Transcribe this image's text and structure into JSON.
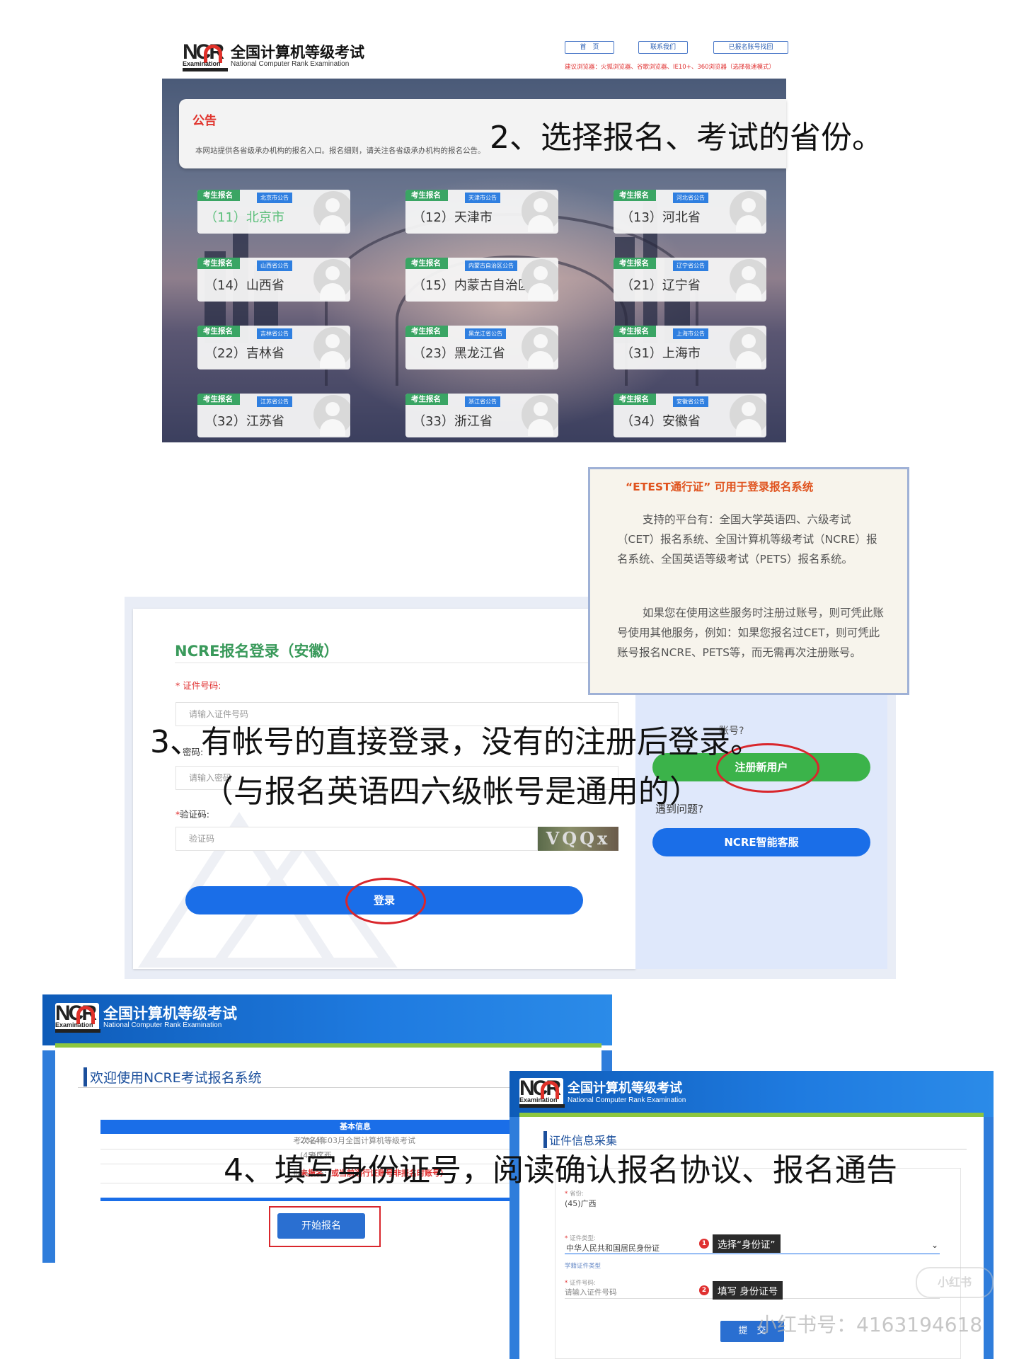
{
  "panel1": {
    "logo": {
      "mark": "NCR",
      "ex": "Examination",
      "title": "全国计算机等级考试",
      "subtitle": "National Computer Rank Examination"
    },
    "nav": [
      "首　页",
      "联系我们",
      "已报名账号找回"
    ],
    "browser_tip": "建议浏览器：火狐浏览器、谷歌浏览器、IE10+、360浏览器（选择极速模式）",
    "notice_title": "公告",
    "notice_text": "本网站提供各省级承办机构的报名入口。报名细则，请关注各省级承办机构的报名公告。",
    "annotation": "2、选择报名、考试的省份。",
    "reg_tag": "考生报名",
    "provinces": [
      {
        "name": "（11）北京市",
        "notice": "北京市公告",
        "highlight": true
      },
      {
        "name": "（12）天津市",
        "notice": "天津市公告"
      },
      {
        "name": "（13）河北省",
        "notice": "河北省公告"
      },
      {
        "name": "（14）山西省",
        "notice": "山西省公告"
      },
      {
        "name": "（15）内蒙古自治区",
        "notice": "内蒙古自治区公告"
      },
      {
        "name": "（21）辽宁省",
        "notice": "辽宁省公告"
      },
      {
        "name": "（22）吉林省",
        "notice": "吉林省公告"
      },
      {
        "name": "（23）黑龙江省",
        "notice": "黑龙江省公告"
      },
      {
        "name": "（31）上海市",
        "notice": "上海市公告"
      },
      {
        "name": "（32）江苏省",
        "notice": "江苏省公告"
      },
      {
        "name": "（33）浙江省",
        "notice": "浙江省公告"
      },
      {
        "name": "（34）安徽省",
        "notice": "安徽省公告"
      }
    ]
  },
  "panel2": {
    "title": "NCRE报名登录（安徽）",
    "id_label": "证件号码:",
    "id_placeholder": "请输入证件号码",
    "pwd_label": "密码:",
    "pwd_placeholder": "请输入密码",
    "captcha_label": "验证码:",
    "captcha_placeholder": "验证码",
    "captcha_text": "VQQx",
    "login_button": "登录",
    "account_question": "账号?",
    "register_button": "注册新用户",
    "help_question": "遇到问题?",
    "service_button": "NCRE智能客服",
    "popup": {
      "title": "“ETEST通行证” 可用于登录报名系统",
      "para1": "支持的平台有：全国大学英语四、六级考试（CET）报名系统、全国计算机等级考试（NCRE）报名系统、全国英语等级考试（PETS）报名系统。",
      "para2": "如果您在使用这些服务时注册过账号，则可凭此账号使用其他服务，例如：如果您报名过CET，则可凭此账号报名NCRE、PETS等，而无需再次注册账号。"
    },
    "annotation_line1": "3、有帐号的直接登录，没有的注册后登录。",
    "annotation_line2": "（与报名英语四六级帐号是通用的）"
  },
  "panel3": {
    "logo": {
      "mark": "NCR",
      "ex": "Examination",
      "title": "全国计算机等级考试",
      "subtitle": "National Computer Rank Examination"
    },
    "welcome": "欢迎使用NCRE考试报名系统",
    "info_header": "基本信息",
    "rows": [
      {
        "key": "考次名称:",
        "value": "2024年03月全国计算机等级考试"
      },
      {
        "key": "考区:",
        "value": "(45)广西"
      },
      {
        "key": "报名状态:",
        "value": "未报名（或当前通行证账号非报名时账号）",
        "status": true
      }
    ],
    "start_button": "开始报名"
  },
  "panel4": {
    "logo": {
      "mark": "NCR",
      "ex": "Examination",
      "title": "全国计算机等级考试",
      "subtitle": "National Computer Rank Examination"
    },
    "title": "证件信息采集",
    "province_label": "省份:",
    "province_value": "(45)广西",
    "idtype_label": "证件类型:",
    "idtype_value": "中华人民共和国居民身份证",
    "idtype_hint": "学籍证件类型",
    "idnum_label": "证件号码:",
    "idnum_placeholder": "请输入证件号码",
    "step1": "选择“身份证”",
    "step2": "填写 身份证号",
    "submit_button": "提　交",
    "annotation": "4、填写身份证号，阅读确认报名协议、报名通告",
    "watermark": "小红书号：4163194618",
    "watermark_logo": "小红书"
  }
}
